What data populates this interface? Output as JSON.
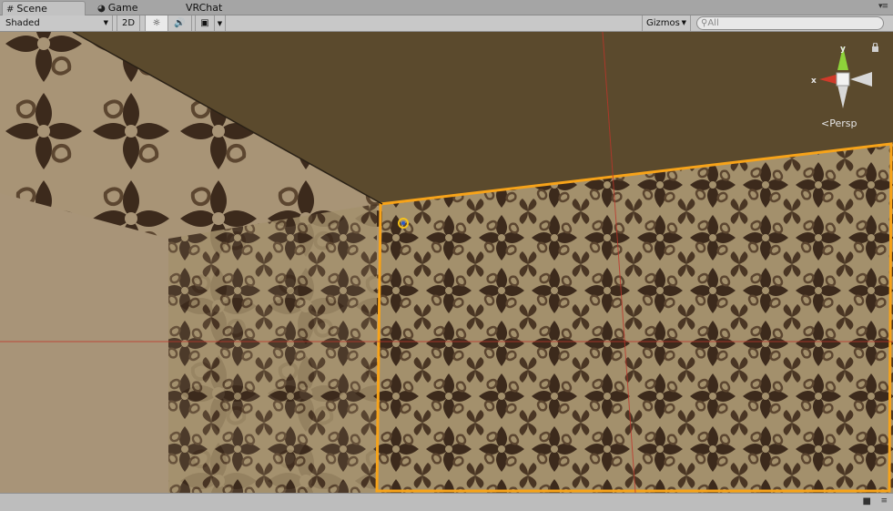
{
  "tabs": [
    {
      "label": "Scene",
      "icon": "grid-icon",
      "active": true
    },
    {
      "label": "Game",
      "icon": "pacman-icon",
      "active": false
    },
    {
      "label": "VRChat",
      "icon": "",
      "active": false
    }
  ],
  "toolbar": {
    "shading_mode": "Shaded",
    "toggle_2d": "2D",
    "gizmos_label": "Gizmos",
    "search_placeholder": "All"
  },
  "viewport": {
    "projection_label": "Persp",
    "gizmo_axes": {
      "x": "x",
      "y": "y"
    }
  },
  "colors": {
    "selection_outline": "#f7a319",
    "ceiling": "#5b4a2d",
    "wall_base": "#a3906c",
    "pattern": "#3c2a1c",
    "axis_red": "#c0342a"
  }
}
